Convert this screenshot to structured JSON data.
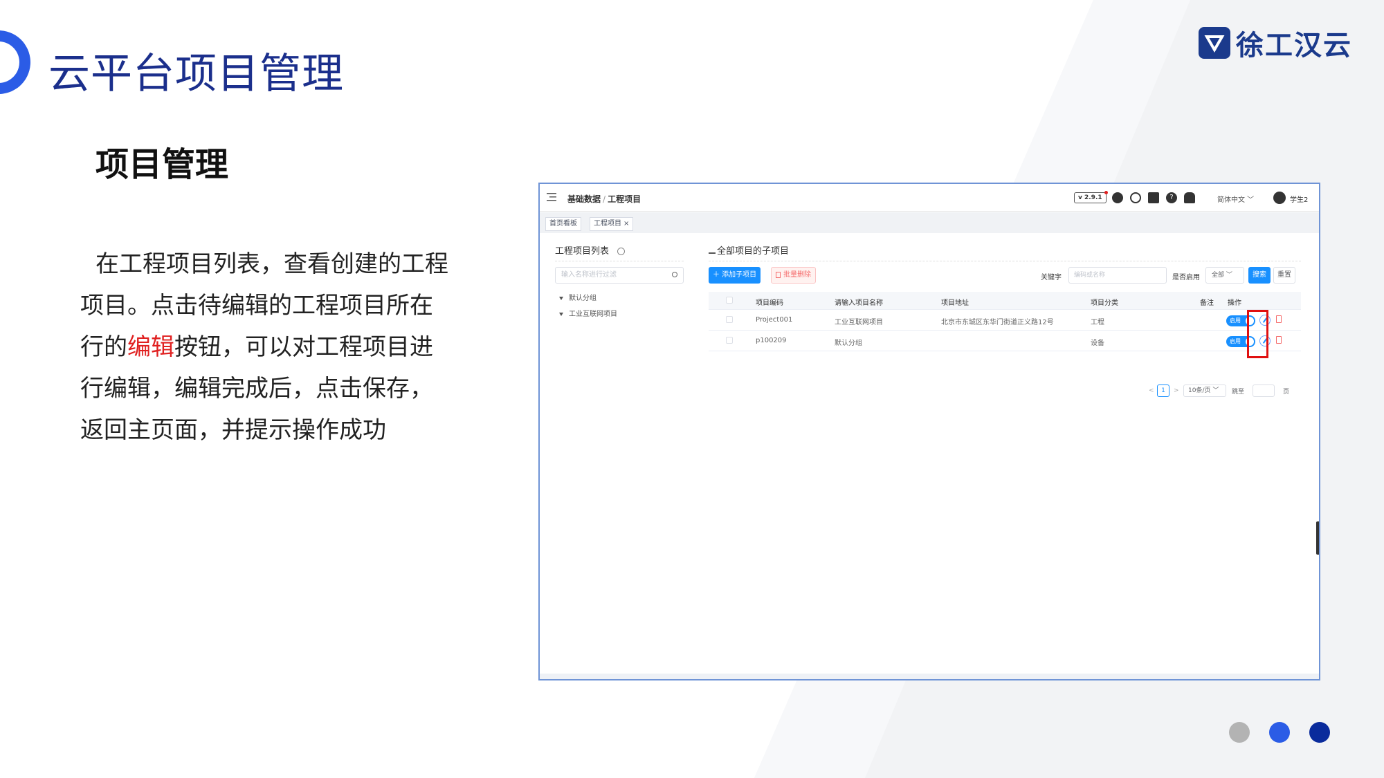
{
  "slide": {
    "title": "云平台项目管理",
    "brand": "徐工汉云",
    "section_title": "项目管理",
    "desc_before": "在工程项目列表，查看创建的工程项目。点击待编辑的工程项目所在行的",
    "desc_highlight": "编辑",
    "desc_after": "按钮，可以对工程项目进行编辑，编辑完成后，点击保存，返回主页面，并提示操作成功",
    "dot_colors": [
      "#b3b3b3",
      "#2b5ce6",
      "#0a2b9c"
    ]
  },
  "app": {
    "breadcrumb_parent": "基础数据",
    "breadcrumb_sep": "/",
    "breadcrumb_current": "工程项目",
    "version": "v 2.9.1",
    "help_icon_glyph": "?",
    "language": "简体中文 ﹀",
    "user": "学生2",
    "tabs": [
      {
        "label": "首页看板"
      },
      {
        "label": "工程项目",
        "close": "×"
      }
    ],
    "left_panel": {
      "title": "工程项目列表",
      "search_placeholder": "输入名称进行过滤",
      "tree": [
        "默认分组",
        "工业互联网项目"
      ]
    },
    "right_panel": {
      "title": "全部项目的子项目",
      "add_button": "＋ 添加子项目",
      "batch_delete_button": "批量删除",
      "keyword_label": "关键字",
      "keyword_placeholder": "编码或名称",
      "enabled_label": "是否启用",
      "enabled_value": "全部 ﹀",
      "search_button": "搜索",
      "reset_button": "重置"
    },
    "table": {
      "headers": [
        "项目编码",
        "请输入项目名称",
        "项目地址",
        "项目分类",
        "备注",
        "操作"
      ],
      "rows": [
        {
          "code": "Project001",
          "name": "工业互联网项目",
          "address": "北京市东城区东华门街道正义路12号",
          "category": "工程",
          "note": "",
          "status": "启用"
        },
        {
          "code": "p100209",
          "name": "默认分组",
          "address": "",
          "category": "设备",
          "note": "",
          "status": "启用"
        }
      ]
    },
    "pagination": {
      "prev": "<",
      "page": "1",
      "next": ">",
      "page_size": "10条/页 ﹀",
      "goto_label": "跳至",
      "page_unit": "页"
    },
    "accent_color": "#1890ff",
    "highlight_box_color": "#e01010"
  }
}
